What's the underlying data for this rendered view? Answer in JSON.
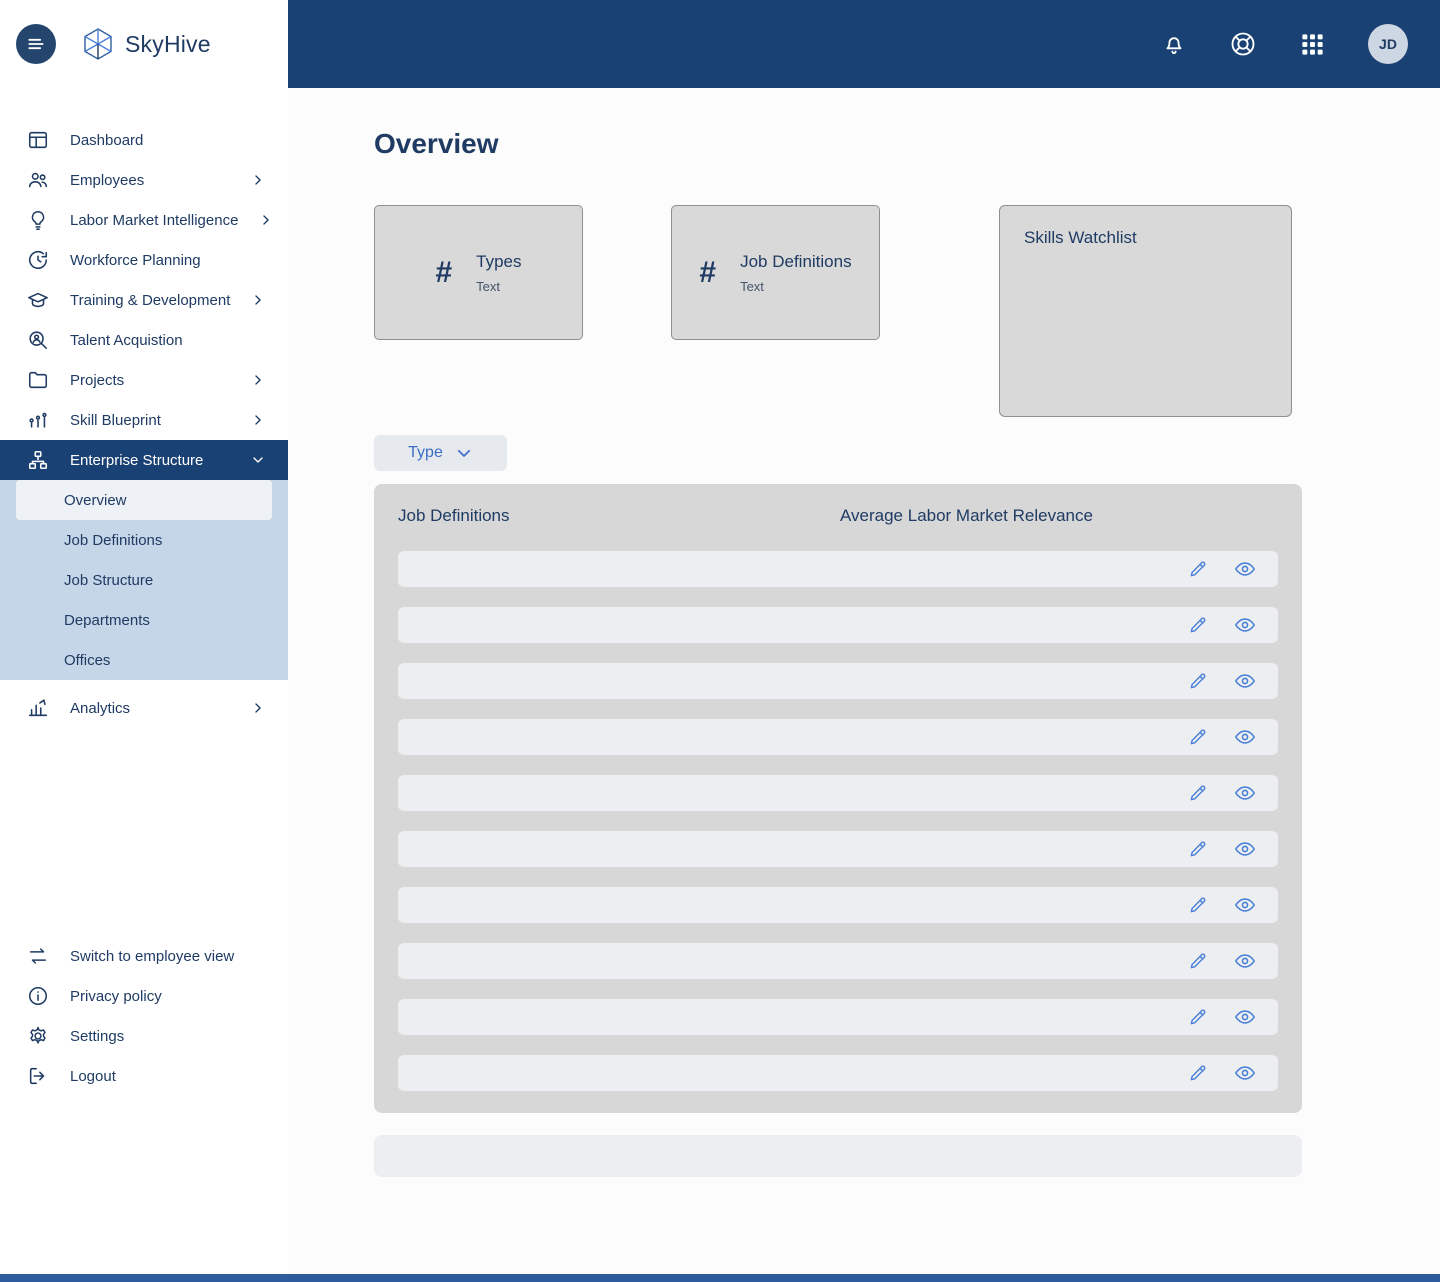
{
  "header": {
    "brand": "SkyHive",
    "avatar": "JD"
  },
  "sidebar": {
    "items": [
      {
        "label": "Dashboard"
      },
      {
        "label": "Employees",
        "expandable": true
      },
      {
        "label": "Labor Market Intelligence",
        "expandable": true
      },
      {
        "label": "Workforce Planning"
      },
      {
        "label": "Training & Development",
        "expandable": true
      },
      {
        "label": "Talent Acquistion"
      },
      {
        "label": "Projects",
        "expandable": true
      },
      {
        "label": "Skill Blueprint",
        "expandable": true
      },
      {
        "label": "Enterprise Structure",
        "expanded": true
      },
      {
        "label": "Analytics",
        "expandable": true
      }
    ],
    "enterprise_submenu": {
      "items": [
        {
          "label": "Overview",
          "selected": true
        },
        {
          "label": "Job Definitions"
        },
        {
          "label": "Job Structure"
        },
        {
          "label": "Departments"
        },
        {
          "label": "Offices"
        }
      ]
    },
    "footer_items": [
      {
        "label": "Switch to employee view"
      },
      {
        "label": "Privacy policy"
      },
      {
        "label": "Settings"
      },
      {
        "label": "Logout"
      }
    ]
  },
  "main": {
    "title": "Overview",
    "stat_cards": [
      {
        "symbol": "#",
        "title": "Types",
        "subtitle": "Text"
      },
      {
        "symbol": "#",
        "title": "Job Definitions",
        "subtitle": "Text"
      }
    ],
    "watchlist_card": {
      "title": "Skills Watchlist"
    },
    "type_filter": {
      "label": "Type"
    },
    "table": {
      "columns": [
        "Job Definitions",
        "Average Labor Market Relevance"
      ],
      "row_count": 10
    }
  },
  "colors": {
    "brand_navy": "#1a4173",
    "text_navy": "#1f3b63",
    "accent_blue": "#4a80d9",
    "submenu_blue": "#c5d6e8",
    "footer_strip_blue": "#2d5b9b"
  }
}
